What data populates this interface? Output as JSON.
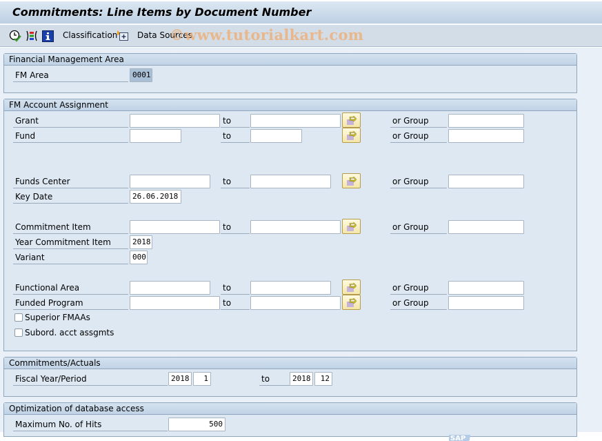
{
  "window": {
    "title": "Commitments: Line Items by Document Number"
  },
  "toolbar": {
    "execute_icon": "clock-check-icon",
    "selection_options_icon": "multi-select-icon",
    "info_icon": "info-icon",
    "classification_label": "Classification",
    "data_sources_icon": "data-sources-icon",
    "data_sources_label": "Data Sources"
  },
  "watermark": "©www.tutorialkart.com",
  "groups": {
    "fm_area": {
      "title": "Financial Management Area",
      "fm_area_label": "FM Area",
      "fm_area_value": "0001"
    },
    "fm_account": {
      "title": "FM Account Assignment",
      "to_label": "to",
      "or_group_label": "or Group",
      "grant_label": "Grant",
      "grant_from": "",
      "grant_to": "",
      "grant_group": "",
      "fund_label": "Fund",
      "fund_from": "",
      "fund_to": "",
      "fund_group": "",
      "funds_center_label": "Funds Center",
      "funds_center_from": "",
      "funds_center_to": "",
      "funds_center_group": "",
      "key_date_label": "Key Date",
      "key_date_value": "26.06.2018",
      "commitment_item_label": "Commitment Item",
      "commitment_item_from": "",
      "commitment_item_to": "",
      "commitment_item_group": "",
      "year_commitment_item_label": "Year Commitment Item",
      "year_commitment_item_value": "2018",
      "variant_label": "Variant",
      "variant_value": "000",
      "functional_area_label": "Functional Area",
      "functional_area_from": "",
      "functional_area_to": "",
      "functional_area_group": "",
      "funded_program_label": "Funded Program",
      "funded_program_from": "",
      "funded_program_to": "",
      "funded_program_group": "",
      "superior_fmaas_label": "Superior FMAAs",
      "superior_fmaas_checked": false,
      "subord_label": "Subord. acct assgmts",
      "subord_checked": false
    },
    "commitments": {
      "title": "Commitments/Actuals",
      "fiscal_label": "Fiscal Year/Period",
      "from_year": "2018",
      "from_period": "1",
      "to_label": "to",
      "to_year": "2018",
      "to_period": "12"
    },
    "optimization": {
      "title": "Optimization of database access",
      "max_hits_label": "Maximum No. of Hits",
      "max_hits_value": "500"
    }
  },
  "footer": {
    "logo": "SAP"
  }
}
